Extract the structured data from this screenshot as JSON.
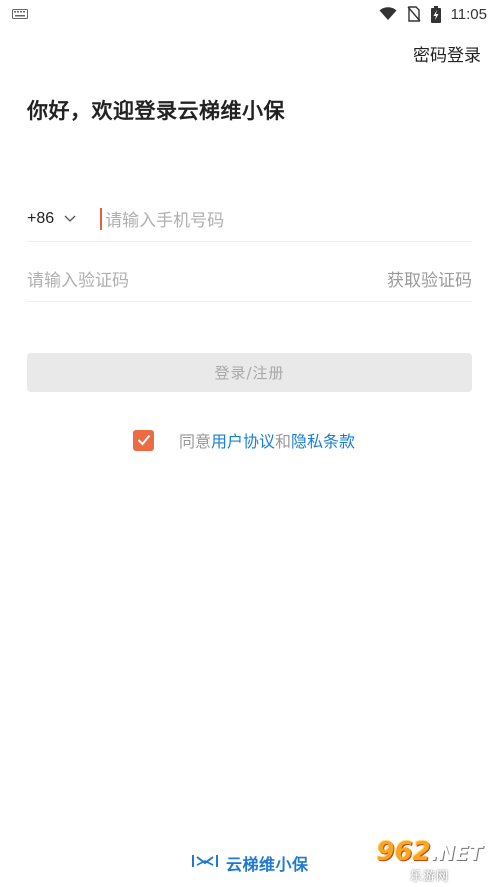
{
  "status_bar": {
    "time": "11:05",
    "icons": [
      "keyboard-icon",
      "wifi-icon",
      "no-sim-icon",
      "battery-charging-icon"
    ]
  },
  "header": {
    "password_login_label": "密码登录",
    "welcome_title": "你好，欢迎登录云梯维小保"
  },
  "form": {
    "country_code": "+86",
    "phone_placeholder": "请输入手机号码",
    "code_placeholder": "请输入验证码",
    "get_code_label": "获取验证码",
    "submit_label": "登录/注册"
  },
  "agreement": {
    "checked": true,
    "prefix": "同意",
    "user_agreement": "用户协议",
    "and": "和",
    "privacy_policy": "隐私条款"
  },
  "footer": {
    "brand": "云梯维小保"
  },
  "watermark": {
    "main": "962",
    "suffix": ".NET",
    "sub": "乐游网"
  },
  "colors": {
    "accent": "#ec6a44",
    "link": "#1a7fd4",
    "disabled_button_bg": "#e9e9e9"
  }
}
